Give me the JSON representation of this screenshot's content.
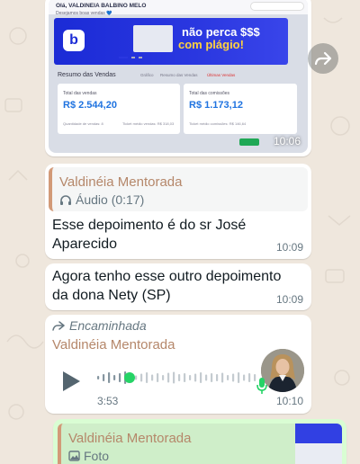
{
  "image_message": {
    "time": "10:06",
    "screenshot": {
      "greeting": "Olá, VALDINEIA BALBINO MELO",
      "subtitle": "Desejamos boas vendas 💙",
      "banner_line1": "não perca $$$",
      "banner_line2": "com plágio!",
      "banner_logo": "b",
      "section_title": "Resumo das Vendas",
      "tabs": [
        "Gráfico",
        "Resumo das Vendas",
        "Últimas Vendas"
      ],
      "card_sales_label": "Total das vendas",
      "card_sales_value": "R$ 2.544,20",
      "card_sales_foot": "Quantidade de vendas: 8",
      "card_sales_foot2": "Ticket médio vendas: R$ 318,03",
      "card_comm_label": "Total das comissões",
      "card_comm_value": "R$ 1.173,12",
      "card_comm_foot": "Ticket médio comissões: R$ 146,64"
    }
  },
  "quoted_message": {
    "quote_name": "Valdinéia Mentorada",
    "quote_detail": "Áudio (0:17)",
    "text": "Esse depoimento é do sr José Aparecido",
    "time": "10:09"
  },
  "text_message": {
    "text": "Agora tenho esse outro depoimento da dona Nety (SP)",
    "time": "10:09"
  },
  "voice_message": {
    "forwarded_label": "Encaminhada",
    "sender": "Valdinéia Mentorada",
    "duration": "3:53",
    "time": "10:10",
    "progress": 0.2
  },
  "outgoing_message": {
    "quote_name": "Valdinéia Mentorada",
    "quote_detail": "Foto"
  },
  "colors": {
    "wallpaper": "#efe7dd",
    "incoming_bubble": "#ffffff",
    "outgoing_bubble": "#d9fdd3",
    "quote_name": "#b5876a",
    "voice_accent": "#25d366"
  }
}
